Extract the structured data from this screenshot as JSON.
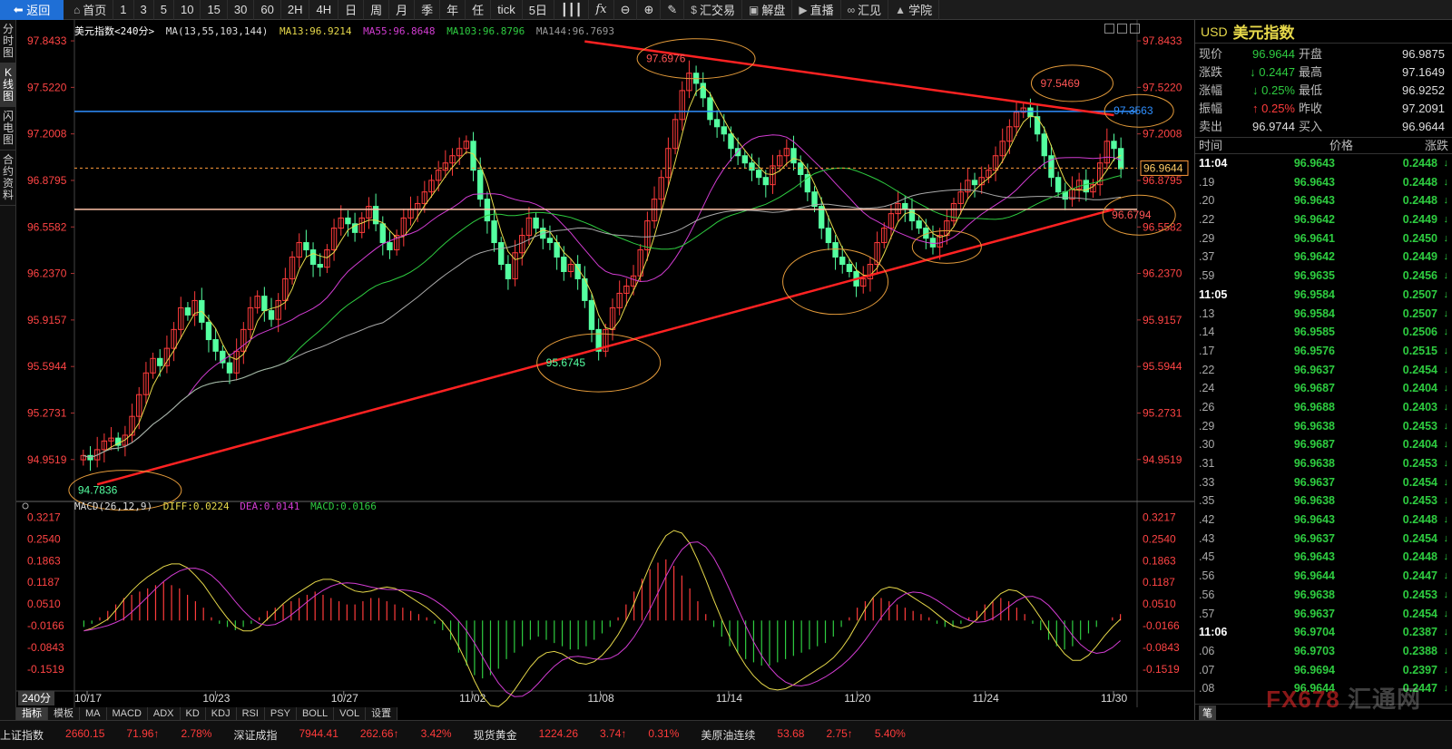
{
  "toolbar": {
    "back": "返回",
    "home": "首页",
    "periods": [
      "1",
      "3",
      "5",
      "10",
      "15",
      "30",
      "60",
      "2H",
      "4H",
      "日",
      "周",
      "月",
      "季",
      "年",
      "任",
      "tick"
    ],
    "five_day": "5日",
    "fx": "fx",
    "trade": "汇交易",
    "analysis": "解盘",
    "live": "直播",
    "huijian": "汇见",
    "school": "学院"
  },
  "vtabs": [
    "分时图",
    "K线图",
    "闪电图",
    "合约资料"
  ],
  "legend": {
    "name": "美元指数<240分>",
    "ma": "MA(13,55,103,144)",
    "ma13": "MA13:96.9214",
    "ma55": "MA55:96.8648",
    "ma103": "MA103:96.8796",
    "ma144": "MA144:96.7693"
  },
  "macd_legend": {
    "name": "MACD(26,12,9)",
    "diff": "DIFF:0.0224",
    "dea": "DEA:0.0141",
    "macd": "MACD:0.0166"
  },
  "period_label": "240分",
  "bottom_tabs": [
    "指标",
    "模板",
    "MA",
    "MACD",
    "ADX",
    "KD",
    "KDJ",
    "RSI",
    "PSY",
    "BOLL",
    "VOL",
    "设置"
  ],
  "ticker": [
    {
      "name": "上证指数",
      "value": "2660.15",
      "change": "71.96↑",
      "pct": "2.78%"
    },
    {
      "name": "深证成指",
      "value": "7944.41",
      "change": "262.66↑",
      "pct": "3.42%"
    },
    {
      "name": "现货黄金",
      "value": "1224.26",
      "change": "3.74↑",
      "pct": "0.31%"
    },
    {
      "name": "美原油连续",
      "value": "53.68",
      "change": "2.75↑",
      "pct": "5.40%"
    }
  ],
  "panel": {
    "code": "USD",
    "name": "美元指数",
    "quote": [
      {
        "l1": "现价",
        "v1": "96.9644",
        "c1": "#2ecc40",
        "l2": "开盘",
        "v2": "96.9875",
        "c2": "#dddddd"
      },
      {
        "l1": "涨跌",
        "v1": "↓ 0.2447",
        "c1": "#2ecc40",
        "l2": "最高",
        "v2": "97.1649",
        "c2": "#dddddd"
      },
      {
        "l1": "涨幅",
        "v1": "↓ 0.25%",
        "c1": "#2ecc40",
        "l2": "最低",
        "v2": "96.9252",
        "c2": "#dddddd"
      },
      {
        "l1": "振幅",
        "v1": "↑ 0.25%",
        "c1": "#ff3b3b",
        "l2": "昨收",
        "v2": "97.2091",
        "c2": "#dddddd"
      },
      {
        "l1": "卖出",
        "v1": "96.9744",
        "c1": "#dddddd",
        "l2": "买入",
        "v2": "96.9644",
        "c2": "#dddddd"
      }
    ],
    "ticks_head": [
      "时间",
      "价格",
      "涨跌"
    ],
    "ticks": [
      {
        "t": "11:04",
        "p": "96.9643",
        "c": "0.2448",
        "full": true
      },
      {
        "t": ".19",
        "p": "96.9643",
        "c": "0.2448"
      },
      {
        "t": ".20",
        "p": "96.9643",
        "c": "0.2448"
      },
      {
        "t": ".22",
        "p": "96.9642",
        "c": "0.2449"
      },
      {
        "t": ".29",
        "p": "96.9641",
        "c": "0.2450"
      },
      {
        "t": ".37",
        "p": "96.9642",
        "c": "0.2449"
      },
      {
        "t": ".59",
        "p": "96.9635",
        "c": "0.2456"
      },
      {
        "t": "11:05",
        "p": "96.9584",
        "c": "0.2507",
        "full": true
      },
      {
        "t": ".13",
        "p": "96.9584",
        "c": "0.2507"
      },
      {
        "t": ".14",
        "p": "96.9585",
        "c": "0.2506"
      },
      {
        "t": ".17",
        "p": "96.9576",
        "c": "0.2515"
      },
      {
        "t": ".22",
        "p": "96.9637",
        "c": "0.2454"
      },
      {
        "t": ".24",
        "p": "96.9687",
        "c": "0.2404"
      },
      {
        "t": ".26",
        "p": "96.9688",
        "c": "0.2403"
      },
      {
        "t": ".29",
        "p": "96.9638",
        "c": "0.2453"
      },
      {
        "t": ".30",
        "p": "96.9687",
        "c": "0.2404"
      },
      {
        "t": ".31",
        "p": "96.9638",
        "c": "0.2453"
      },
      {
        "t": ".33",
        "p": "96.9637",
        "c": "0.2454"
      },
      {
        "t": ".35",
        "p": "96.9638",
        "c": "0.2453"
      },
      {
        "t": ".42",
        "p": "96.9643",
        "c": "0.2448"
      },
      {
        "t": ".43",
        "p": "96.9637",
        "c": "0.2454"
      },
      {
        "t": ".45",
        "p": "96.9643",
        "c": "0.2448"
      },
      {
        "t": ".56",
        "p": "96.9644",
        "c": "0.2447"
      },
      {
        "t": ".56",
        "p": "96.9638",
        "c": "0.2453"
      },
      {
        "t": ".57",
        "p": "96.9637",
        "c": "0.2454"
      },
      {
        "t": "11:06",
        "p": "96.9704",
        "c": "0.2387",
        "full": true
      },
      {
        "t": ".06",
        "p": "96.9703",
        "c": "0.2388"
      },
      {
        "t": ".07",
        "p": "96.9694",
        "c": "0.2397"
      },
      {
        "t": ".08",
        "p": "96.9644",
        "c": "0.2447"
      }
    ],
    "pen": "笔"
  },
  "watermark": {
    "fx": "FX678",
    "cn": "汇通网"
  },
  "chart_data": {
    "type": "candlestick",
    "price_ticks": [
      "97.8433",
      "97.5220",
      "97.2008",
      "96.8795",
      "96.5582",
      "96.2370",
      "95.9157",
      "95.5944",
      "95.2731",
      "94.9519"
    ],
    "price_range": [
      94.7,
      97.9
    ],
    "macd_ticks": [
      "0.3217",
      "0.2540",
      "0.1863",
      "0.1187",
      "0.0510",
      "-0.0166",
      "-0.0843",
      "-0.1519"
    ],
    "macd_range": [
      -0.205,
      0.345
    ],
    "x_labels": [
      "10/17",
      "10/23",
      "10/27",
      "11/02",
      "11/08",
      "11/14",
      "11/20",
      "11/24",
      "11/30"
    ],
    "annotations": [
      "97.6976",
      "97.5469",
      "97.3563",
      "96.6794",
      "95.6745",
      "94.7836"
    ],
    "current_price": "96.9644",
    "horizontal_levels": {
      "blue": 97.3563,
      "orange": 96.6794,
      "current": 96.9644
    },
    "closes": [
      94.98,
      94.95,
      95.02,
      95.08,
      95.1,
      95.05,
      95.12,
      95.25,
      95.4,
      95.55,
      95.65,
      95.6,
      95.72,
      95.85,
      96.0,
      95.95,
      96.05,
      95.9,
      95.78,
      95.7,
      95.62,
      95.55,
      95.7,
      95.85,
      96.0,
      96.08,
      95.98,
      95.92,
      96.05,
      96.2,
      96.35,
      96.45,
      96.4,
      96.3,
      96.28,
      96.4,
      96.55,
      96.62,
      96.58,
      96.52,
      96.62,
      96.7,
      96.58,
      96.45,
      96.4,
      96.5,
      96.62,
      96.68,
      96.72,
      96.8,
      96.88,
      96.95,
      97.0,
      97.05,
      97.1,
      97.15,
      96.95,
      96.75,
      96.6,
      96.45,
      96.3,
      96.2,
      96.38,
      96.5,
      96.62,
      96.55,
      96.48,
      96.45,
      96.35,
      96.25,
      96.3,
      96.2,
      96.05,
      95.85,
      95.7,
      95.85,
      96.0,
      96.1,
      96.15,
      96.22,
      96.4,
      96.6,
      96.75,
      96.9,
      97.1,
      97.3,
      97.5,
      97.62,
      97.55,
      97.45,
      97.3,
      97.25,
      97.2,
      97.1,
      97.05,
      97.0,
      96.95,
      96.9,
      96.85,
      96.98,
      97.05,
      97.1,
      97.0,
      96.92,
      96.8,
      96.7,
      96.55,
      96.45,
      96.35,
      96.3,
      96.25,
      96.15,
      96.2,
      96.3,
      96.45,
      96.55,
      96.65,
      96.72,
      96.68,
      96.6,
      96.55,
      96.48,
      96.42,
      96.5,
      96.6,
      96.72,
      96.8,
      96.88,
      96.85,
      96.9,
      96.95,
      97.05,
      97.15,
      97.25,
      97.35,
      97.38,
      97.32,
      97.2,
      97.05,
      96.9,
      96.8,
      96.75,
      96.82,
      96.88,
      96.8,
      96.85,
      97.0,
      97.15,
      97.1,
      96.96
    ],
    "macd_hist": [
      -0.02,
      -0.01,
      0.01,
      0.03,
      0.05,
      0.07,
      0.08,
      0.09,
      0.1,
      0.11,
      0.12,
      0.11,
      0.1,
      0.08,
      0.06,
      0.04,
      0.01,
      -0.01,
      -0.02,
      -0.03,
      -0.02,
      -0.01,
      0.01,
      0.03,
      0.04,
      0.05,
      0.06,
      0.07,
      0.08,
      0.09,
      0.08,
      0.07,
      0.06,
      0.05,
      0.05,
      0.06,
      0.07,
      0.07,
      0.06,
      0.05,
      0.04,
      0.03,
      0.02,
      0.01,
      -0.01,
      -0.03,
      -0.06,
      -0.1,
      -0.14,
      -0.17,
      -0.18,
      -0.17,
      -0.15,
      -0.12,
      -0.1,
      -0.08,
      -0.06,
      -0.05,
      -0.06,
      -0.07,
      -0.08,
      -0.09,
      -0.09,
      -0.08,
      -0.06,
      -0.04,
      -0.02,
      0.01,
      0.05,
      0.09,
      0.13,
      0.16,
      0.18,
      0.19,
      0.17,
      0.14,
      0.1,
      0.06,
      0.02,
      -0.02,
      -0.05,
      -0.08,
      -0.1,
      -0.12,
      -0.13,
      -0.14,
      -0.14,
      -0.13,
      -0.12,
      -0.11,
      -0.1,
      -0.09,
      -0.08,
      -0.07,
      -0.05,
      -0.02,
      0.01,
      0.04,
      0.06,
      0.07,
      0.07,
      0.06,
      0.05,
      0.04,
      0.03,
      0.02,
      0.01,
      -0.01,
      -0.02,
      -0.02,
      -0.01,
      0.01,
      0.03,
      0.05,
      0.06,
      0.07,
      0.06,
      0.04,
      0.02,
      -0.01,
      -0.03,
      -0.06,
      -0.08,
      -0.09,
      -0.08,
      -0.06,
      -0.04,
      -0.02,
      0.0,
      0.01,
      0.02
    ]
  }
}
